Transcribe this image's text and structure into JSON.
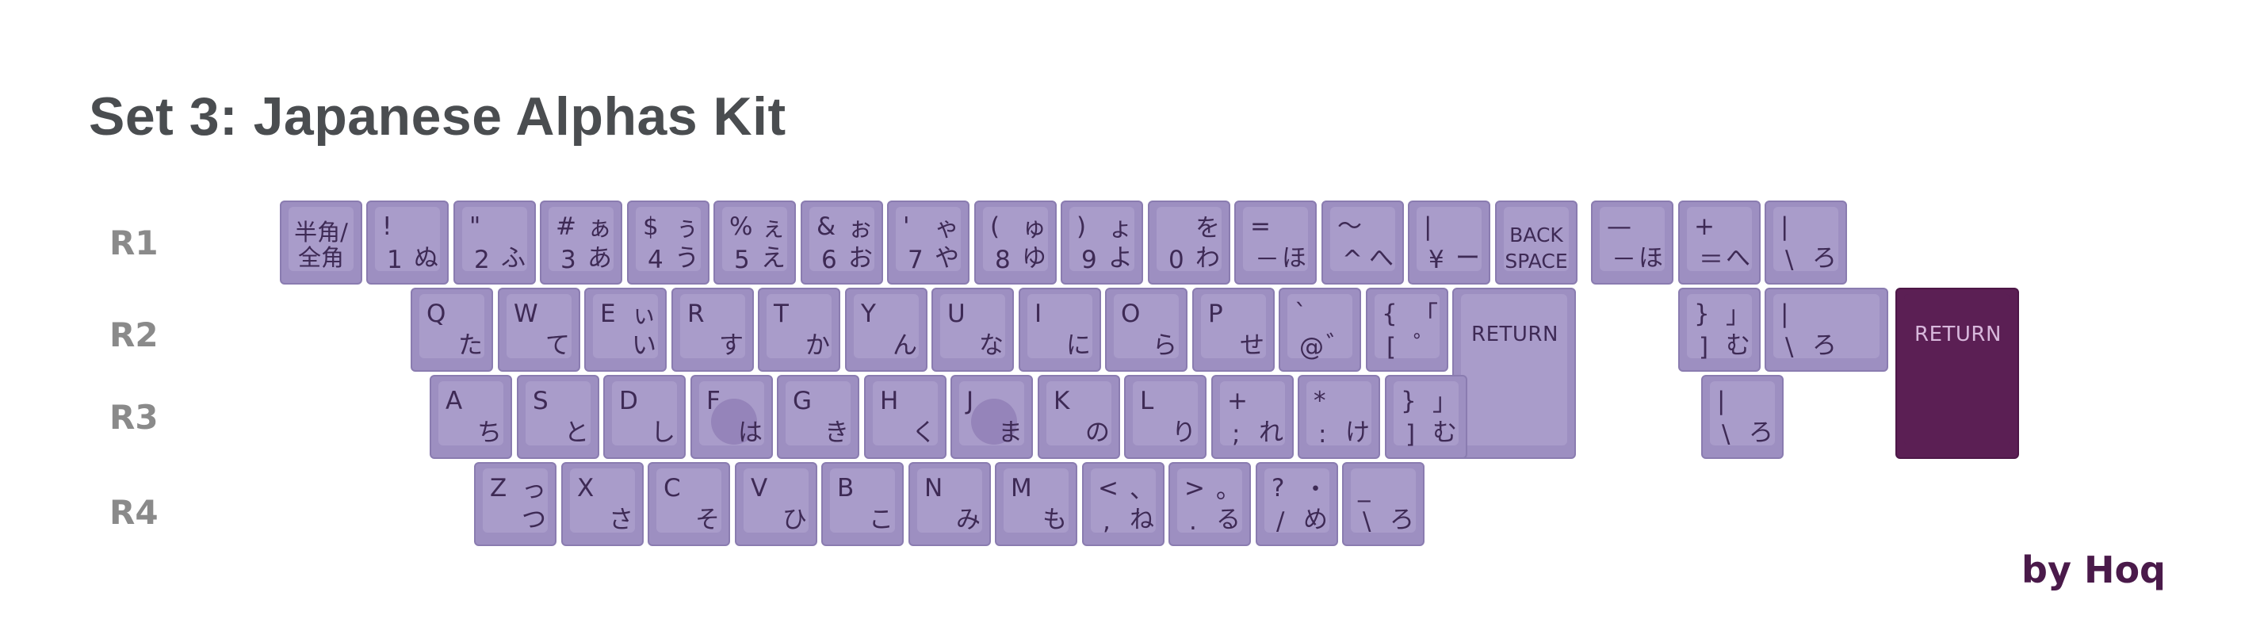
{
  "title": "Set 3: Japanese Alphas Kit",
  "credit": "by Hoq",
  "row_labels": [
    "R1",
    "R2",
    "R3",
    "R4"
  ],
  "colors": {
    "key_base": "#9d8fc1",
    "key_top": "#a99cca",
    "legend": "#3e2a55",
    "accent_key": "#5b1f54",
    "accent_legend": "#d8b8dc"
  },
  "rows": {
    "r1": [
      {
        "center": "半角/\n全角"
      },
      {
        "tl": "!",
        "bl": "1",
        "br": "ぬ"
      },
      {
        "tl": "\"",
        "bl": "2",
        "br": "ふ"
      },
      {
        "tl": "#",
        "tr": "ぁ",
        "bl": "3",
        "br": "あ"
      },
      {
        "tl": "$",
        "tr": "ぅ",
        "bl": "4",
        "br": "う"
      },
      {
        "tl": "%",
        "tr": "ぇ",
        "bl": "5",
        "br": "え"
      },
      {
        "tl": "&",
        "tr": "ぉ",
        "bl": "6",
        "br": "お"
      },
      {
        "tl": "'",
        "tr": "ゃ",
        "bl": "7",
        "br": "や"
      },
      {
        "tl": "(",
        "tr": "ゅ",
        "bl": "8",
        "br": "ゆ"
      },
      {
        "tl": ")",
        "tr": "ょ",
        "bl": "9",
        "br": "よ"
      },
      {
        "tr": "を",
        "bl": "0",
        "br": "わ"
      },
      {
        "tl": "=",
        "bl": "－",
        "br": "ほ"
      },
      {
        "tl": "〜",
        "bl": "^",
        "br": "へ"
      },
      {
        "tl": "|",
        "bl": "¥",
        "br": "ー"
      },
      {
        "word2": "BACK\nSPACE"
      },
      {
        "tl": "—",
        "bl": "－",
        "br": "ほ"
      },
      {
        "tl": "+",
        "bl": "＝",
        "br": "へ"
      },
      {
        "tl": "|",
        "bl": "\\",
        "br": "ろ"
      }
    ],
    "r2": [
      {
        "tl": "Q",
        "br": "た"
      },
      {
        "tl": "W",
        "br": "て"
      },
      {
        "tl": "E",
        "tr": "ぃ",
        "br": "い"
      },
      {
        "tl": "R",
        "br": "す"
      },
      {
        "tl": "T",
        "br": "か"
      },
      {
        "tl": "Y",
        "br": "ん"
      },
      {
        "tl": "U",
        "br": "な"
      },
      {
        "tl": "I",
        "br": "に"
      },
      {
        "tl": "O",
        "br": "ら"
      },
      {
        "tl": "P",
        "br": "せ"
      },
      {
        "tl": "`",
        "bl": "@",
        "br": "゛"
      },
      {
        "tl": "{",
        "tr": "「",
        "bl": "[",
        "br": "゜"
      },
      {
        "word": "RETURN"
      },
      {
        "tl": "}",
        "tr": "」",
        "bl": "]",
        "br": "む"
      },
      {
        "tl": "|",
        "bl": "\\",
        "br": "ろ"
      },
      {
        "word": "RETURN"
      }
    ],
    "r3": [
      {
        "tl": "A",
        "br": "ち"
      },
      {
        "tl": "S",
        "br": "と"
      },
      {
        "tl": "D",
        "br": "し"
      },
      {
        "tl": "F",
        "br": "は"
      },
      {
        "tl": "G",
        "br": "き"
      },
      {
        "tl": "H",
        "br": "く"
      },
      {
        "tl": "J",
        "br": "ま"
      },
      {
        "tl": "K",
        "br": "の"
      },
      {
        "tl": "L",
        "br": "り"
      },
      {
        "tl": "+",
        "bl": ";",
        "br": "れ"
      },
      {
        "tl": "*",
        "bl": ":",
        "br": "け"
      },
      {
        "tl": "}",
        "tr": "」",
        "bl": "]",
        "br": "む"
      },
      {
        "tl": "|",
        "bl": "\\",
        "br": "ろ"
      }
    ],
    "r4": [
      {
        "tl": "Z",
        "tr": "っ",
        "br": "つ"
      },
      {
        "tl": "X",
        "br": "さ"
      },
      {
        "tl": "C",
        "br": "そ"
      },
      {
        "tl": "V",
        "br": "ひ"
      },
      {
        "tl": "B",
        "br": "こ"
      },
      {
        "tl": "N",
        "br": "み"
      },
      {
        "tl": "M",
        "br": "も"
      },
      {
        "tl": "<",
        "tr": "、",
        "bl": ",",
        "br": "ね"
      },
      {
        "tl": ">",
        "tr": "。",
        "bl": ".",
        "br": "る"
      },
      {
        "tl": "?",
        "tr": "・",
        "bl": "/",
        "br": "め"
      },
      {
        "tl": "_",
        "bl": "\\",
        "br": "ろ"
      }
    ]
  }
}
